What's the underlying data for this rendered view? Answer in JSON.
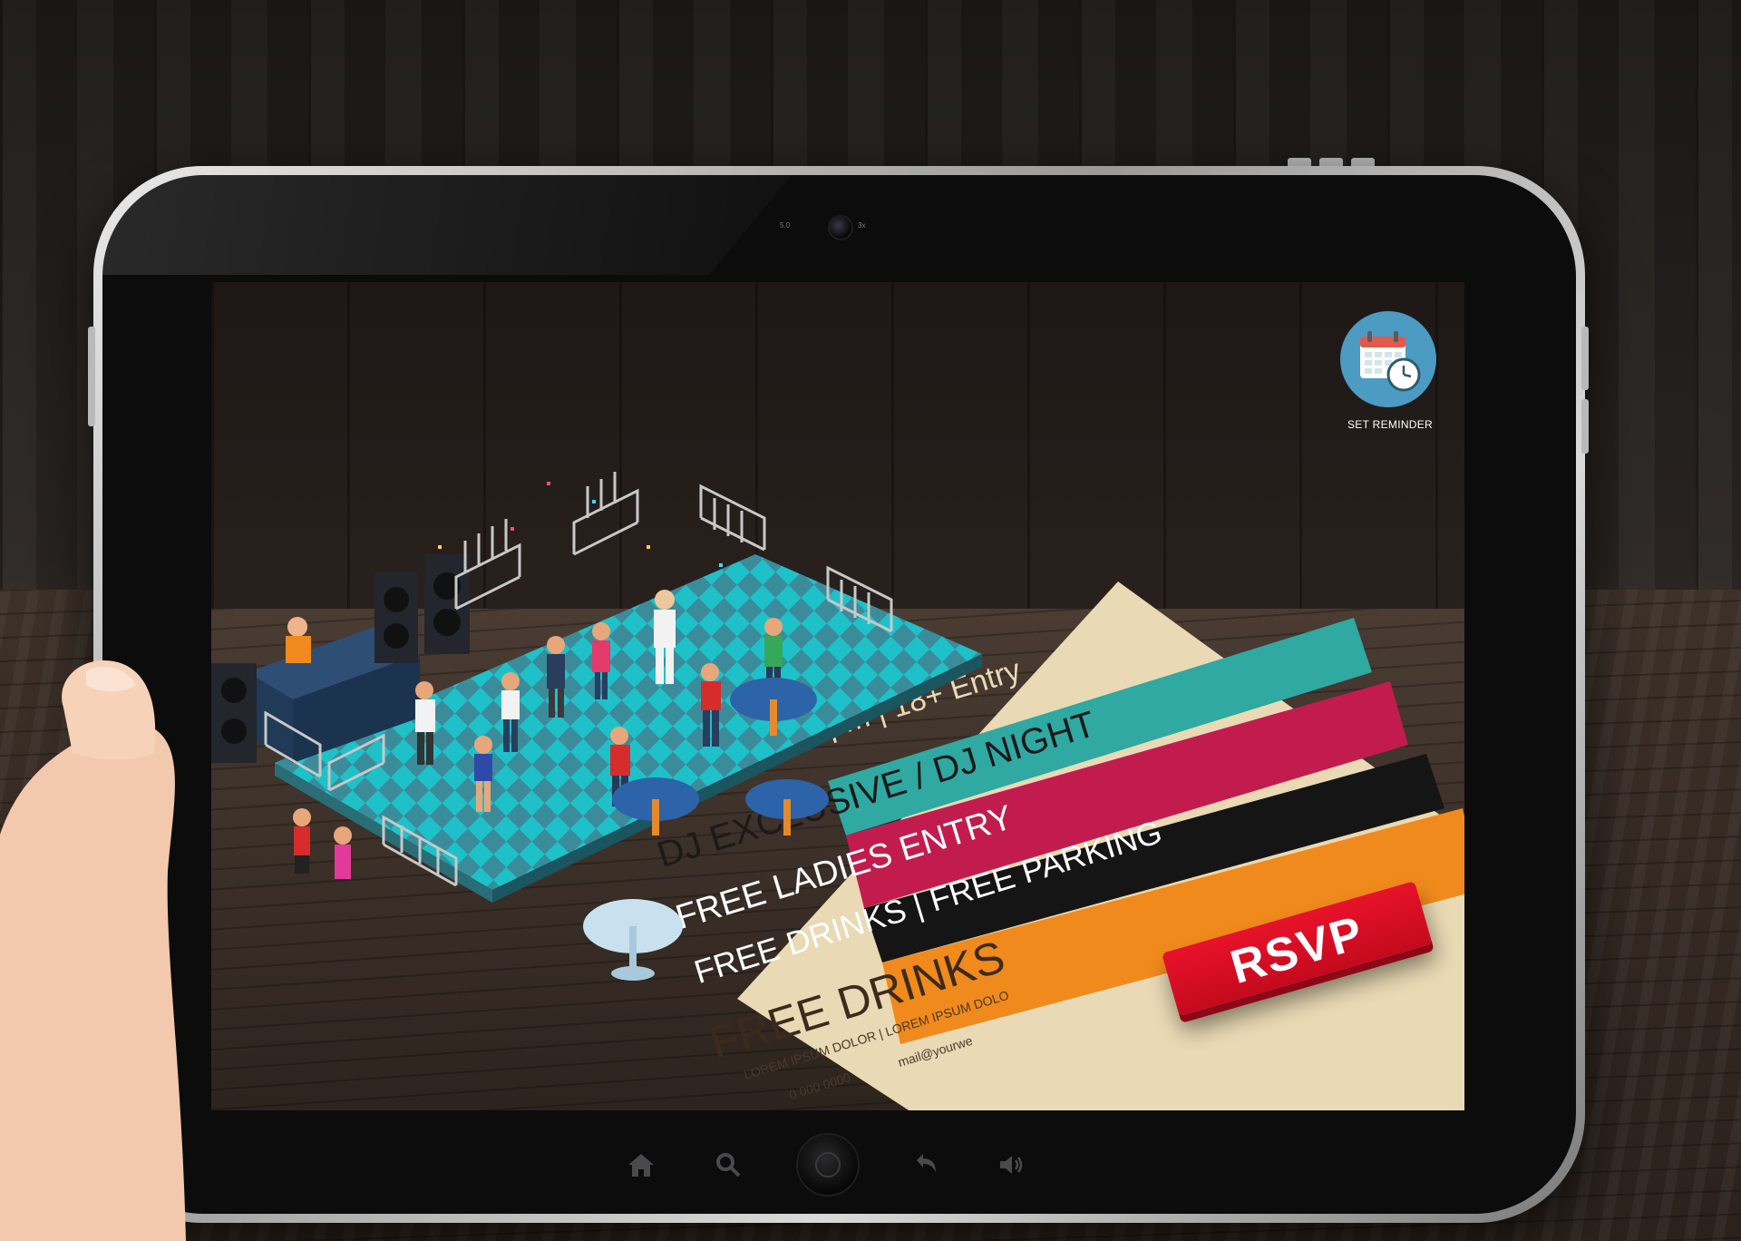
{
  "screen": {
    "reminder": {
      "label": "SET REMINDER",
      "icon": "calendar-clock-icon",
      "color": "#4b9bc2"
    },
    "flyer": {
      "lines": [
        {
          "text": "Sat 12 Sept | 5 pm | 18+ Entry",
          "color": "#e9d9b4"
        },
        {
          "text": "DJ EXCLUSIVE / DJ NIGHT",
          "color": "#2b2b2b"
        },
        {
          "text": "FREE LADIES ENTRY",
          "color": "#ffffff"
        },
        {
          "text": "FREE DRINKS | FREE PARKING",
          "color": "#ffffff"
        },
        {
          "text": "FREE DRINKS",
          "color": "#3d2a1c"
        },
        {
          "text": "LOREM IPSUM DOLOR | LOREM IPSUM DOLO",
          "color": "#4a3a2a"
        },
        {
          "text": "0 000 0000",
          "color": "#4a3a2a"
        },
        {
          "text": "mail@yourwe",
          "color": "#4a3a2a"
        }
      ],
      "band_colors": [
        "#2fa9a1",
        "#c21c4f",
        "#151515",
        "#f08a1c",
        "#e9d9b4"
      ]
    },
    "rsvp": {
      "label": "RSVP",
      "color": "#e8122a"
    }
  },
  "tablet": {
    "camera_labels": [
      "5.0",
      "3x"
    ],
    "nav": [
      {
        "name": "home-icon"
      },
      {
        "name": "search-icon"
      },
      {
        "name": "home-button"
      },
      {
        "name": "back-icon"
      },
      {
        "name": "volume-icon"
      }
    ]
  }
}
